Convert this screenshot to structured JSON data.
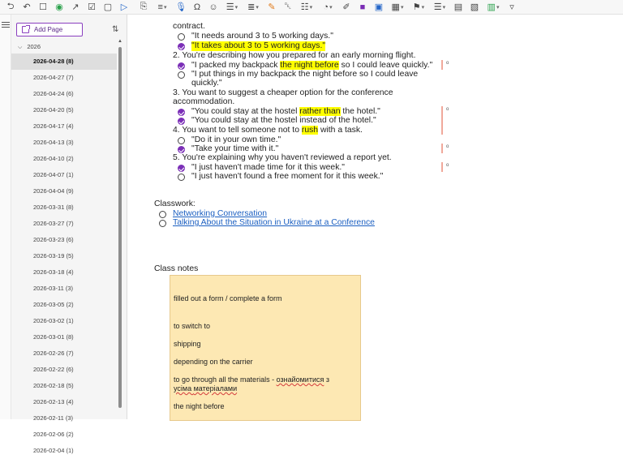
{
  "toolbar": {
    "icons": [
      "back-icon",
      "undo-icon",
      "page-icon",
      "record-icon",
      "pin-icon",
      "tag-icon",
      "square-icon",
      "play-icon",
      "clip-icon",
      "paragraph-icon",
      "mic-icon",
      "omega-icon",
      "emoji-icon",
      "insert-icon",
      "format-icon",
      "highlighter-icon",
      "delete-icon",
      "note-icon",
      "tag-color-icon",
      "pen-icon",
      "onenote-icon",
      "share-icon",
      "table-icon",
      "link-icon",
      "more-icon",
      "view-icon",
      "sticky-icon",
      "layout-icon",
      "dropdown-icon"
    ]
  },
  "sidebar": {
    "add_page_label": "Add Page",
    "section_label": "2026",
    "pages": [
      {
        "label": "2026-04-28 (8)",
        "active": true
      },
      {
        "label": "2026-04-27 (7)"
      },
      {
        "label": "2026-04-24 (6)"
      },
      {
        "label": "2026-04-20 (5)"
      },
      {
        "label": "2026-04-17 (4)"
      },
      {
        "label": "2026-04-13 (3)"
      },
      {
        "label": "2026-04-10 (2)"
      },
      {
        "label": "2026-04-07 (1)"
      },
      {
        "label": "2026-04-04 (9)"
      },
      {
        "label": "2026-03-31 (8)"
      },
      {
        "label": "2026-03-27 (7)"
      },
      {
        "label": "2026-03-23 (6)"
      },
      {
        "label": "2026-03-19 (5)"
      },
      {
        "label": "2026-03-18 (4)"
      },
      {
        "label": "2026-03-11 (3)"
      },
      {
        "label": "2026-03-05 (2)"
      },
      {
        "label": "2026-03-02 (1)"
      },
      {
        "label": "2026-03-01 (8)"
      },
      {
        "label": "2026-02-26 (7)"
      },
      {
        "label": "2026-02-22 (6)"
      },
      {
        "label": "2026-02-18 (5)"
      },
      {
        "label": "2026-02-13 (4)"
      },
      {
        "label": "2026-02-11 (3)"
      },
      {
        "label": "2026-02-06 (2)"
      },
      {
        "label": "2026-02-04 (1)"
      }
    ]
  },
  "content": {
    "top_cut": "contract.",
    "q1_a": "\"It needs around 3 to 5 working days.\"",
    "q1_b": "\"It takes about 3 to 5 working days.\"",
    "q2": "2. You're describing how you prepared for an early morning flight.",
    "q2_a_pre": "\"I packed my backpack ",
    "q2_a_hl": "the night before",
    "q2_a_post": " so I could leave quickly.\"",
    "q2_b_line1": "\"I put things in my backpack the night before so I could leave",
    "q2_b_line2": "quickly.\"",
    "q3_line1": "3. You want to suggest a cheaper option for the conference",
    "q3_line2": "accommodation.",
    "q3_a_pre": "\"You could stay at the hostel ",
    "q3_a_hl": "rather than",
    "q3_a_post": " the hotel.\"",
    "q3_b": "\"You could stay at the hostel instead of the hotel.\"",
    "q4_pre": "4. You want to tell someone not to ",
    "q4_hl": "rush",
    "q4_post": " with a task.",
    "q4_a": "\"Do it in your own time.\"",
    "q4_b": "\"Take your time with it.\"",
    "q5": "5. You're explaining why you haven't reviewed a report yet.",
    "q5_a": "\"I just haven't made time for it this week.\"",
    "q5_b": "\"I just haven't found a free moment for it this week.\"",
    "classwork_label": "Classwork:",
    "link1": "Networking Conversation",
    "link2": "Talking About the Situation in Ukraine at a Conference",
    "class_notes_label": "Class notes",
    "notes": {
      "line1": "filled out a form / complete  a form",
      "line2": "to switch to",
      "line3": "shipping",
      "line4": "depending on the carrier",
      "line5_pre": "to go through all the materials - ",
      "line5_sq": "ознайомитися",
      "line5_post": " з",
      "line6_pre": "усіма ",
      "line6_sq": "матеріалами",
      "line7": "the night before"
    },
    "marker_char": "o"
  }
}
